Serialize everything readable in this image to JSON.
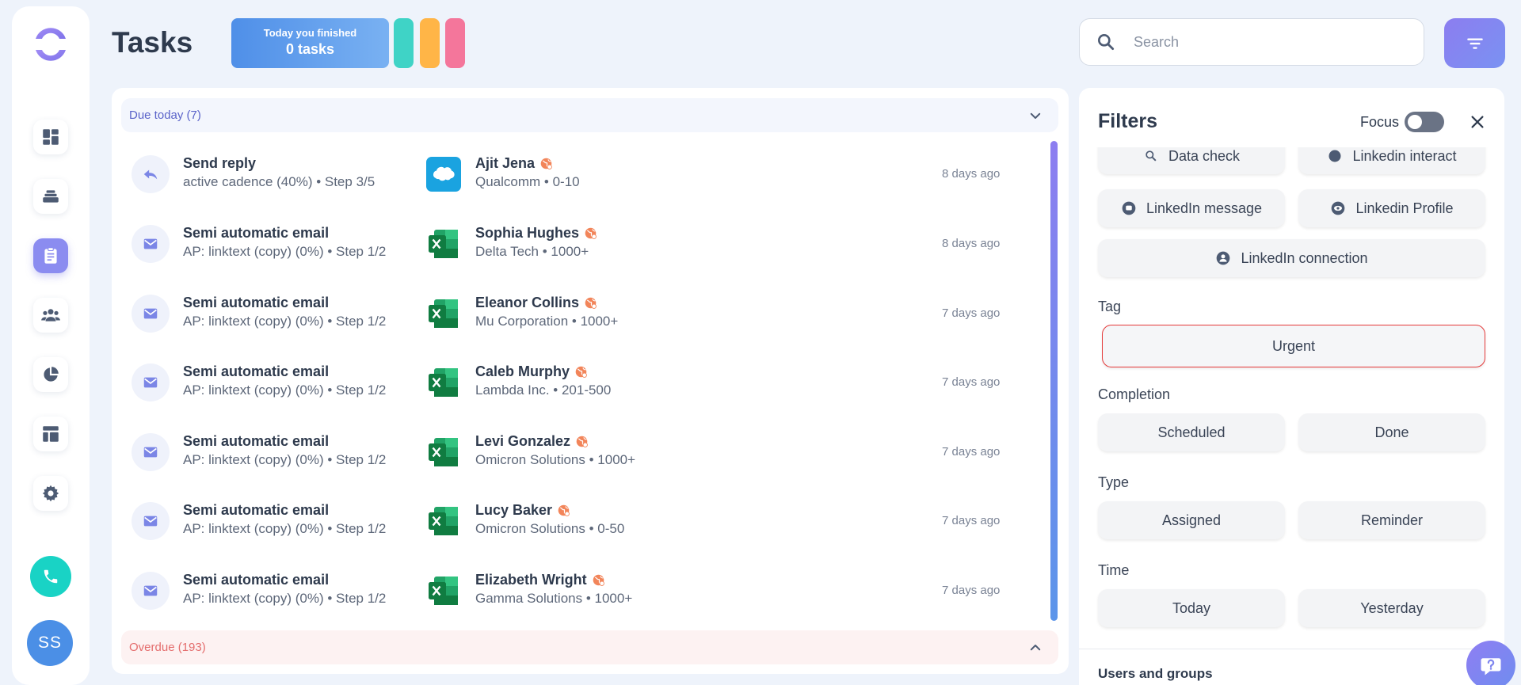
{
  "header": {
    "title": "Tasks",
    "finished_line1": "Today you finished",
    "finished_line2": "0 tasks",
    "stat_colors": [
      "#3fd3c6",
      "#ffb547",
      "#f4769b"
    ],
    "search_placeholder": "Search"
  },
  "sidebar": {
    "items": [
      {
        "icon": "dashboard-icon"
      },
      {
        "icon": "layers-icon"
      },
      {
        "icon": "clipboard-icon",
        "active": true
      },
      {
        "icon": "people-icon"
      },
      {
        "icon": "pie-chart-icon"
      },
      {
        "icon": "template-icon"
      },
      {
        "icon": "gear-icon"
      }
    ],
    "avatar_initials": "SS"
  },
  "tasks": {
    "due_label": "Due today (7)",
    "overdue_label": "Overdue (193)",
    "rows": [
      {
        "kind": "reply",
        "title": "Send reply",
        "subtitle": "active cadence (40%) • Step 3/5",
        "source": "salesforce",
        "contact": "Ajit Jena",
        "company": "Qualcomm • 0-10",
        "time": "8 days ago"
      },
      {
        "kind": "email",
        "title": "Semi automatic email",
        "subtitle": "AP: linktext (copy) (0%) • Step 1/2",
        "source": "excel",
        "contact": "Sophia Hughes",
        "company": "Delta Tech • 1000+",
        "time": "8 days ago"
      },
      {
        "kind": "email",
        "title": "Semi automatic email",
        "subtitle": "AP: linktext (copy) (0%) • Step 1/2",
        "source": "excel",
        "contact": "Eleanor Collins",
        "company": "Mu Corporation • 1000+",
        "time": "7 days ago"
      },
      {
        "kind": "email",
        "title": "Semi automatic email",
        "subtitle": "AP: linktext (copy) (0%) • Step 1/2",
        "source": "excel",
        "contact": "Caleb Murphy",
        "company": "Lambda Inc. • 201-500",
        "time": "7 days ago"
      },
      {
        "kind": "email",
        "title": "Semi automatic email",
        "subtitle": "AP: linktext (copy) (0%) • Step 1/2",
        "source": "excel",
        "contact": "Levi Gonzalez",
        "company": "Omicron Solutions • 1000+",
        "time": "7 days ago"
      },
      {
        "kind": "email",
        "title": "Semi automatic email",
        "subtitle": "AP: linktext (copy) (0%) • Step 1/2",
        "source": "excel",
        "contact": "Lucy Baker",
        "company": "Omicron Solutions • 0-50",
        "time": "7 days ago"
      },
      {
        "kind": "email",
        "title": "Semi automatic email",
        "subtitle": "AP: linktext (copy) (0%) • Step 1/2",
        "source": "excel",
        "contact": "Elizabeth Wright",
        "company": "Gamma Solutions • 1000+",
        "time": "7 days ago"
      }
    ]
  },
  "filters": {
    "title": "Filters",
    "focus_label": "Focus",
    "focus_on": false,
    "action_chips": {
      "data_check": "Data check",
      "linkedin_interact": "Linkedin interact",
      "linkedin_message": "LinkedIn message",
      "linkedin_profile": "Linkedin Profile",
      "linkedin_connection": "LinkedIn connection"
    },
    "tag_label": "Tag",
    "tag_urgent": "Urgent",
    "completion_label": "Completion",
    "completion_scheduled": "Scheduled",
    "completion_done": "Done",
    "type_label": "Type",
    "type_assigned": "Assigned",
    "type_reminder": "Reminder",
    "time_label": "Time",
    "time_today": "Today",
    "time_yesterday": "Yesterday",
    "users_groups_label": "Users and groups"
  }
}
